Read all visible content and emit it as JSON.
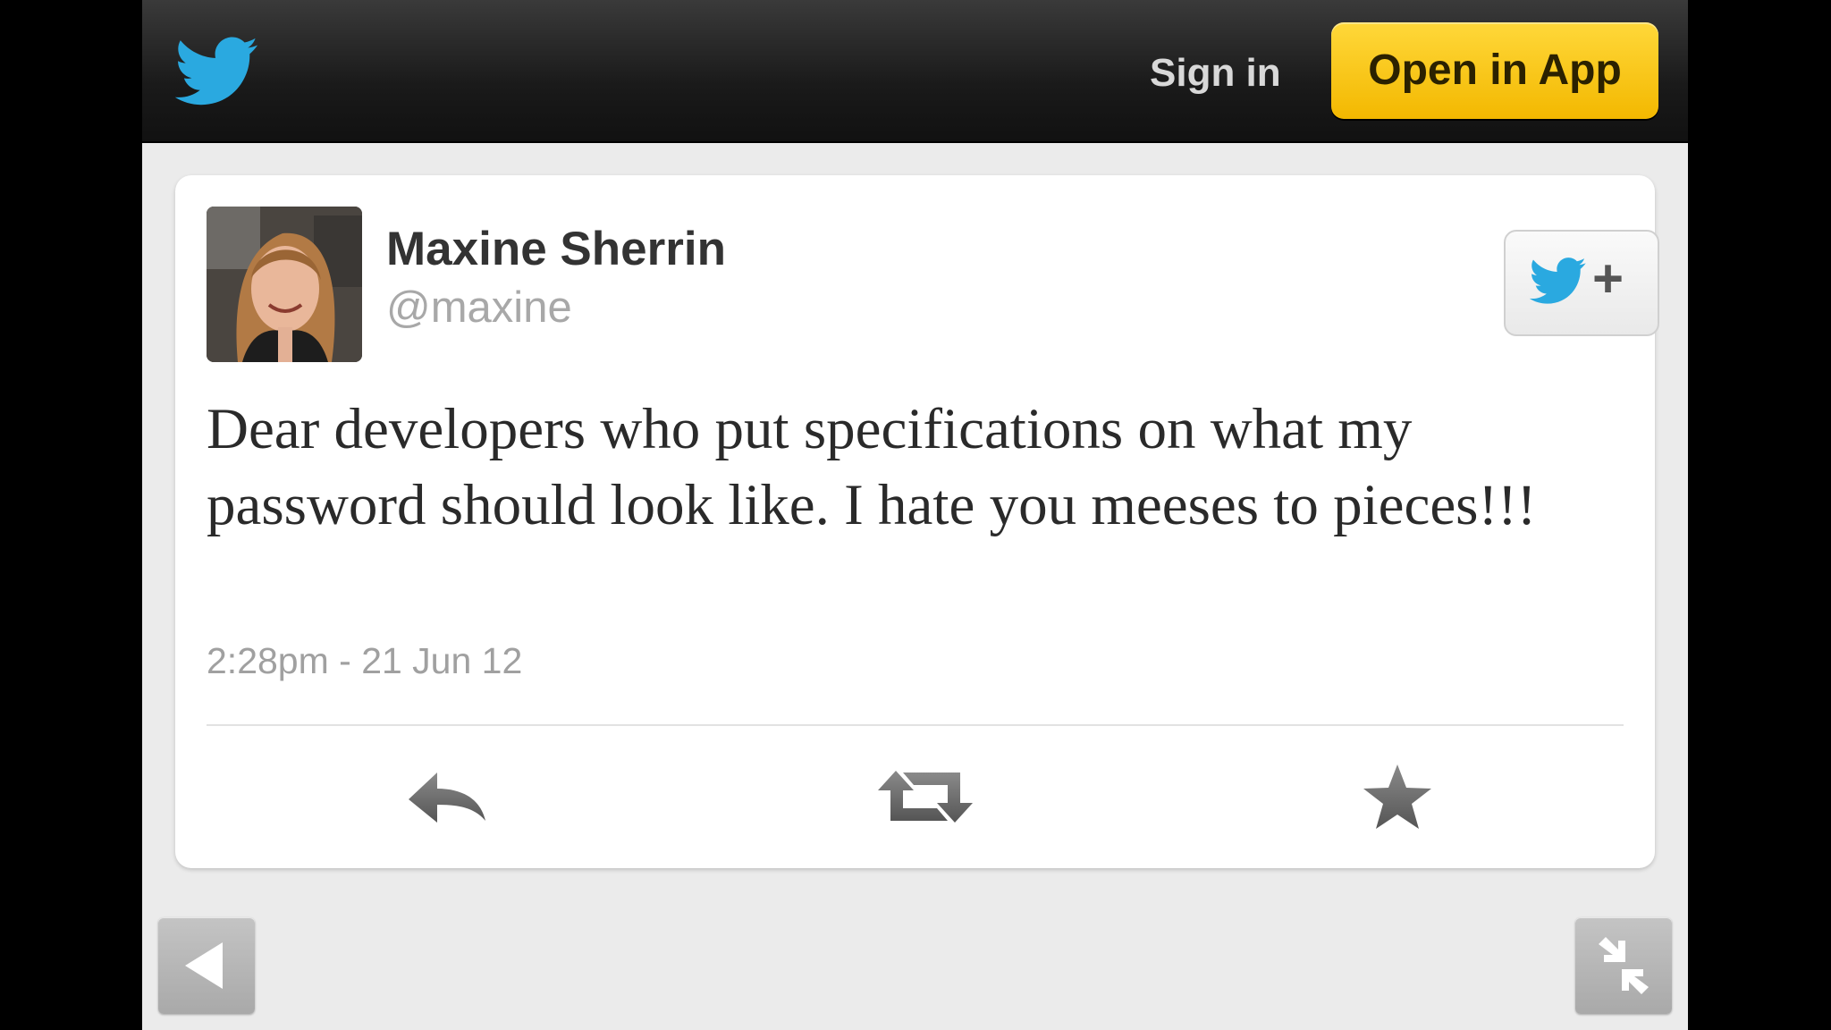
{
  "header": {
    "logo_icon": "twitter-bird-icon",
    "signin_label": "Sign in",
    "open_app_label": "Open in App",
    "accent_color": "#ffd000",
    "brand_color": "#2aa9e0"
  },
  "tweet": {
    "author_name": "Maxine Sherrin",
    "author_handle": "@maxine",
    "follow_icon": "twitter-bird-plus-icon",
    "text": "Dear developers who put specifications on what my password should look like. I hate you meeses to pieces!!!",
    "timestamp": "2:28pm - 21 Jun 12",
    "actions": {
      "reply_icon": "reply-icon",
      "retweet_icon": "retweet-icon",
      "favorite_icon": "star-icon"
    }
  },
  "toolbar": {
    "back_icon": "back-arrow-icon",
    "exit_fullscreen_icon": "exit-fullscreen-icon"
  }
}
